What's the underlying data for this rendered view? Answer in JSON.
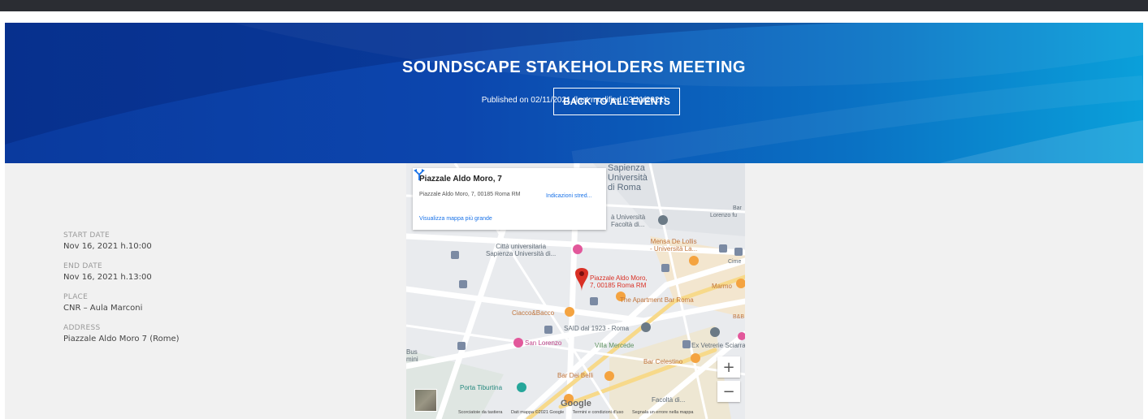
{
  "header": {
    "title": "SOUNDSCAPE STAKEHOLDERS MEETING",
    "published": "Published on 02/11/2021 (last modified 03/11/2021)",
    "back_label": "BACK TO ALL EVENTS"
  },
  "details": {
    "start_label": "START DATE",
    "start_value": "Nov 16, 2021 h.10:00",
    "end_label": "END DATE",
    "end_value": "Nov 16, 2021 h.13:00",
    "place_label": "PLACE",
    "place_value": "CNR – Aula Marconi",
    "address_label": "ADDRESS",
    "address_value": "Piazzale Aldo Moro 7 (Rome)"
  },
  "map": {
    "card": {
      "title": "Piazzale Aldo Moro, 7",
      "address": "Piazzale Aldo Moro, 7, 00185 Roma RM",
      "directions": "Indicazioni stred...",
      "larger_map": "Visualizza mappa più grande"
    },
    "pin_label_line1": "Piazzale Aldo Moro,",
    "pin_label_line2": "7, 00185 Roma RM",
    "places": {
      "sapienza1": "Sapienza",
      "sapienza2": "Università",
      "sapienza3": "di Roma",
      "citta1": "Città universitaria",
      "citta2": "Sapienza Università di...",
      "unita1": "à Università",
      "unita2": "Facoltà di...",
      "mensa1": "Mensa De Lollis",
      "mensa2": "- Università La...",
      "apartment": "The Apartment Bar Roma",
      "cacio": "Ciacco&Bacco",
      "said": "SAID dal 1923 - Roma",
      "sanlorenzo": "San Lorenzo",
      "villa": "Villa Mercede",
      "vetrerie": "Ex Vetrerie Sciarra",
      "celestino": "Bar Celestino",
      "tiburtina": "Porta Tiburtina",
      "beibei": "Bar Dei Belli",
      "facolta": "Facoltà di...",
      "bus": "Bus",
      "mini": "mini",
      "bar": "Bar",
      "lorenzo": "Lorenzo fu",
      "cime": "Cime",
      "marmo": "Marmo",
      "bb": "B&B"
    },
    "google": "Google",
    "attribution": [
      "Scorciatoie da tastiera",
      "Dati mappa ©2021 Google",
      "Termini e condizioni d'uso",
      "Segnala un errore nella mappa"
    ],
    "zoom_in": "+",
    "zoom_out": "−"
  },
  "colors": {
    "hero_start": "#0a3a9e",
    "hero_end": "#0aa0da",
    "label": "#999999",
    "value": "#444444",
    "map_link": "#1a73e8",
    "pin": "#d93025"
  }
}
